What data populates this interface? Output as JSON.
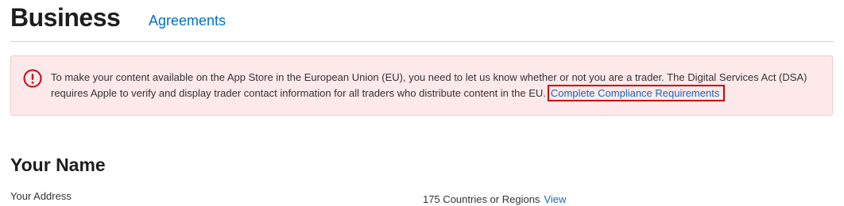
{
  "header": {
    "title": "Business",
    "tabs": [
      {
        "label": "Agreements"
      }
    ]
  },
  "alert": {
    "icon": "exclamation-circle-icon",
    "message": "To make your content available on the App Store in the European Union (EU), you need to let us know whether or not you are a trader. The Digital Services Act (DSA) requires Apple to verify and display trader contact information for all traders who distribute content in the EU.",
    "link_label": "Complete Compliance Requirements"
  },
  "account": {
    "name": "Your Name",
    "address_label": "Your Address",
    "regions_text": "175 Countries or Regions",
    "view_label": "View"
  },
  "colors": {
    "accent": "#0070c9",
    "alert_background": "#fde9ea",
    "alert_icon": "#d0021b",
    "highlight_border": "#cc0000"
  }
}
